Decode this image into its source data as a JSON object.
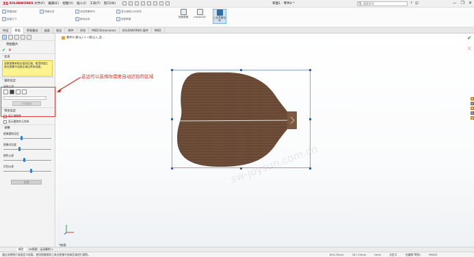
{
  "app": {
    "logo_mark": "3S",
    "logo_text": "SOLIDWORKS"
  },
  "menu": [
    "文件(F)",
    "编辑(E)",
    "视图(V)",
    "插入(I)",
    "工具(T)",
    "窗口(W)"
  ],
  "document_title": "草图1 - 零件4 *",
  "search_placeholder": "搜索命令",
  "ribbon": {
    "left_items": [
      "草图绘制",
      "智能尺寸",
      "镜像实体",
      "线性草图阵列",
      "移动实体",
      "显示/删除几何关系",
      "修复草图",
      "快速捕捉",
      "Instant2D"
    ],
    "big_buttons": [
      "快速草图",
      "Instant2D",
      "上色草图轮廓"
    ]
  },
  "tabs": [
    "特征",
    "草图",
    "草图墨迹",
    "曲面",
    "钣金",
    "焊件",
    "评估",
    "MBD Dimensions",
    "SOLIDWORKS 插件",
    "MBD"
  ],
  "active_tab": "草图",
  "panel": {
    "title": "草图图片",
    "message_section": "信息",
    "message_text": "选取图像来取出填充区域。使用快速工具在图像中选取区域边界来创建。",
    "sec_tools": "跟踪设定",
    "tools_label": "选取工具",
    "start_tracing": "开始跟踪",
    "sec_preview": "预览设定",
    "opt_show_image": "显示源图像",
    "opt_show_trace": "显示跟踪的几何体",
    "sec_adjust": "调整",
    "slider_1": "图像跟踪设定",
    "slider_2": "图像对比度",
    "slider_3": "颜色公差",
    "slider_4": "识别公差",
    "slider_values": [
      0.35,
      0.32,
      0.42,
      0.55
    ],
    "apply": "应用"
  },
  "canvas": {
    "crumb": "零件4 (默认) < <默认>_显...",
    "annotation": "这边可以选择你需要自动识别的区域",
    "watermark": "sw-joysun.com.cn",
    "bottom_label": "*前视"
  },
  "model_tabs": [
    "模型",
    "3D视图",
    "运动算例 1"
  ],
  "status": {
    "message": "通过选择图片或面定义轮廓。使用图像跟踪工具在图像中选取区域进行跟踪。",
    "v1": "604.23mm",
    "v2": "347.15mm",
    "v3": "0mm",
    "v4": "欠定义",
    "v5": "在编辑 草图1",
    "v6": "MMGS"
  },
  "colors": {
    "accent": "#e0281f",
    "brand": "#d0021b",
    "wood": "#6b4a36"
  }
}
